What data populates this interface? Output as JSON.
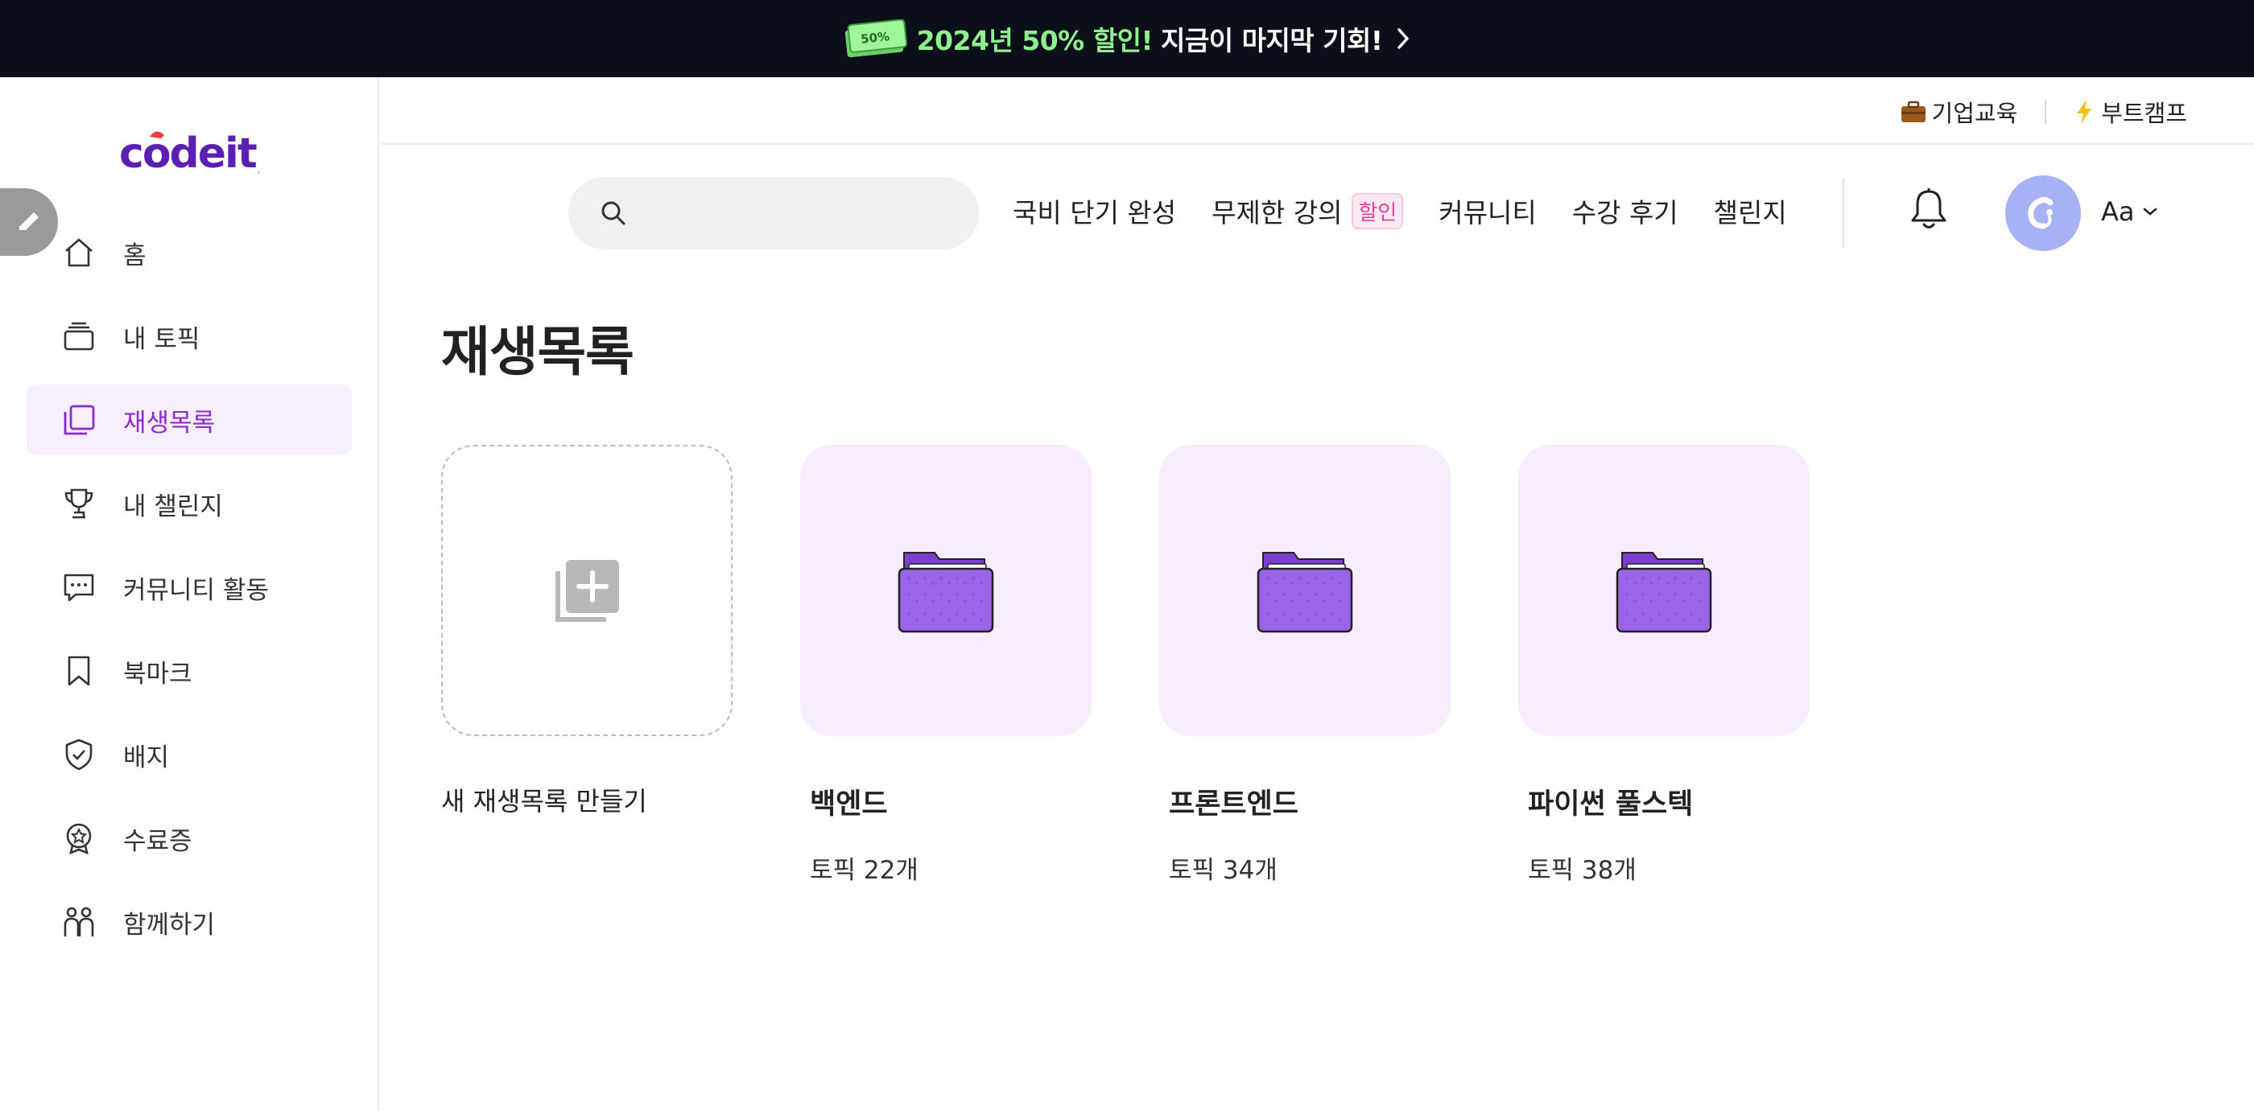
{
  "promo": {
    "ticket_text": "50%",
    "accent": "2024년 50% 할인!",
    "rest": "지금이 마지막 기회!"
  },
  "logo": {
    "text": "codeit;"
  },
  "sidebar": {
    "items": [
      {
        "label": "홈",
        "icon": "home-icon",
        "active": false
      },
      {
        "label": "내 토픽",
        "icon": "stack-icon",
        "active": false
      },
      {
        "label": "재생목록",
        "icon": "playlist-icon",
        "active": true
      },
      {
        "label": "내 챌린지",
        "icon": "trophy-icon",
        "active": false
      },
      {
        "label": "커뮤니티 활동",
        "icon": "chat-icon",
        "active": false
      },
      {
        "label": "북마크",
        "icon": "bookmark-icon",
        "active": false
      },
      {
        "label": "배지",
        "icon": "badge-shield-icon",
        "active": false
      },
      {
        "label": "수료증",
        "icon": "certificate-icon",
        "active": false
      },
      {
        "label": "함께하기",
        "icon": "people-icon",
        "active": false
      }
    ]
  },
  "utilbar": {
    "corporate": "기업교육",
    "bootcamp": "부트캠프"
  },
  "search": {
    "placeholder": "",
    "value": ""
  },
  "main_nav": {
    "items": [
      "국비 단기 완성",
      "무제한 강의",
      "커뮤니티",
      "수강 후기",
      "챌린지"
    ],
    "sale_badge": "할인"
  },
  "font_toggle": "Aa",
  "page": {
    "title": "재생목록",
    "new_playlist_label": "새 재생목록 만들기",
    "playlists": [
      {
        "title": "백엔드",
        "subtitle": "토픽 22개"
      },
      {
        "title": "프론트엔드",
        "subtitle": "토픽 34개"
      },
      {
        "title": "파이썬 풀스텍",
        "subtitle": "토픽 38개"
      }
    ]
  },
  "colors": {
    "promo_bg": "#0b0f19",
    "promo_accent": "#8ef08a",
    "brand_purple": "#5b1fb3",
    "active_bg": "#f7eefe",
    "active_text": "#8a2bd1",
    "folder_purple": "#9a63e8",
    "card_bg": "#f7ecfd",
    "avatar_bg": "#a8b1f6",
    "sale_pink": "#e0449c"
  }
}
